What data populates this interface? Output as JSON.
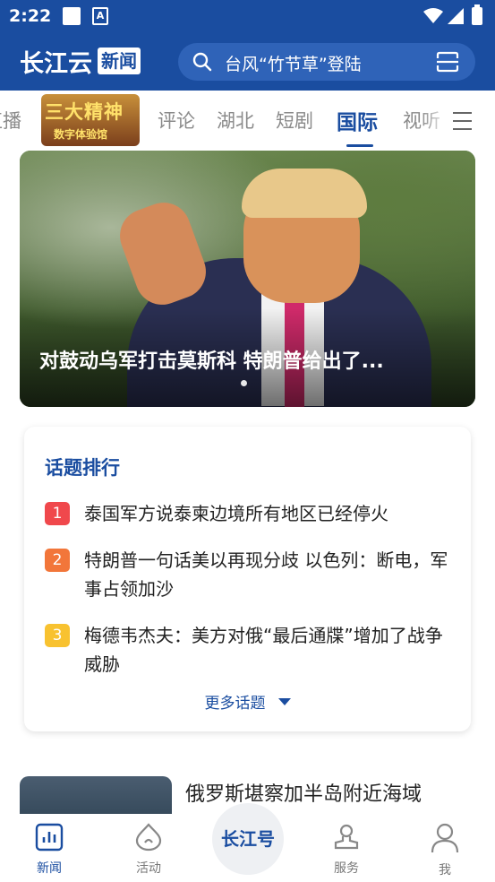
{
  "status_bar": {
    "time": "2:22"
  },
  "header": {
    "logo_text": "长江云",
    "logo_box": "新闻",
    "search_text": "台风“竹节草”登陆"
  },
  "tabs": {
    "items": [
      "直播",
      "评论",
      "湖北",
      "短剧",
      "国际",
      "视听"
    ],
    "active": "国际",
    "badge": {
      "line1": "三大精神",
      "line2": "数字体验馆"
    }
  },
  "banner": {
    "caption": "对鼓动乌军打击莫斯科 特朗普给出了..."
  },
  "topics": {
    "title": "话题排行",
    "items": [
      {
        "rank": "1",
        "text": "泰国军方说泰柬边境所有地区已经停火",
        "color": "#f0484c"
      },
      {
        "rank": "2",
        "text": "特朗普一句话美以再现分歧 以色列：断电，军事占领加沙",
        "color": "#f2763a"
      },
      {
        "rank": "3",
        "text": "梅德韦杰夫：美方对俄“最后通牒”增加了战争威胁",
        "color": "#f8c230"
      }
    ],
    "more_label": "更多话题"
  },
  "news": {
    "title": "俄罗斯堪察加半岛附近海域"
  },
  "bottom_nav": {
    "items": [
      {
        "label": "新闻",
        "icon": "news-icon"
      },
      {
        "label": "活动",
        "icon": "activity-icon"
      },
      {
        "label": "服务",
        "icon": "service-icon"
      },
      {
        "label": "我",
        "icon": "profile-icon"
      }
    ],
    "center_logo": "长江号",
    "active": "新闻"
  },
  "colors": {
    "brand": "#1a4da0"
  }
}
